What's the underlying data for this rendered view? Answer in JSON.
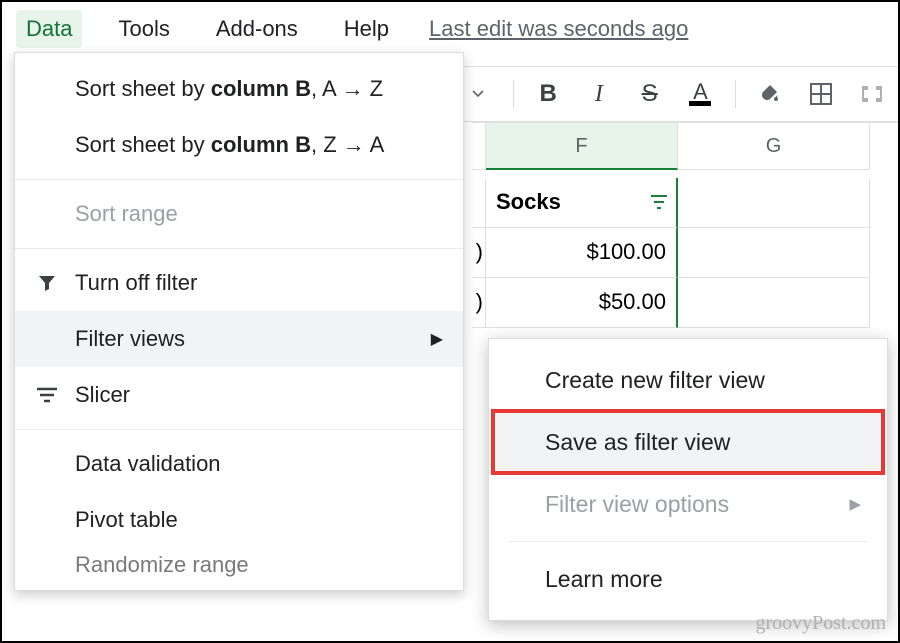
{
  "menubar": {
    "data": "Data",
    "tools": "Tools",
    "addons": "Add-ons",
    "help": "Help",
    "last_edit": "Last edit was seconds ago"
  },
  "toolbar": {
    "bold": "B",
    "italic": "I",
    "strike": "S",
    "text_color": "A"
  },
  "columns": {
    "f": "F",
    "g": "G"
  },
  "sheet": {
    "header_socks": "Socks",
    "row_e_frag_1": ")",
    "row_e_frag_2": ")",
    "val1": "$100.00",
    "val2": "$50.00"
  },
  "data_menu": {
    "sort_az_pre": "Sort sheet by ",
    "sort_az_bold": "column B",
    "sort_az_post": ", A → Z",
    "sort_za_pre": "Sort sheet by ",
    "sort_za_bold": "column B",
    "sort_za_post": ", Z → A",
    "sort_range": "Sort range",
    "turn_off_filter": "Turn off filter",
    "filter_views": "Filter views",
    "slicer": "Slicer",
    "data_validation": "Data validation",
    "pivot_table": "Pivot table",
    "randomize": "Randomize range"
  },
  "filter_submenu": {
    "create": "Create new filter view",
    "save_as": "Save as filter view",
    "options": "Filter view options",
    "learn": "Learn more"
  },
  "watermark": "groovyPost.com"
}
